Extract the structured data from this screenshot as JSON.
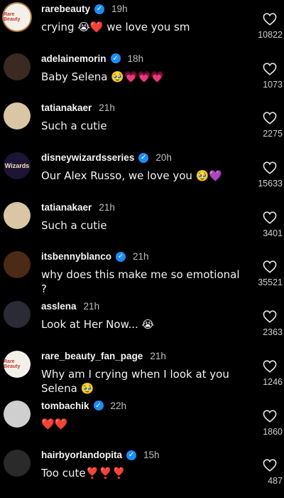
{
  "comments": [
    {
      "username": "rarebeauty",
      "verified": true,
      "time": "19h",
      "text": "crying 😭❤️ we love you sm",
      "likes": "10822",
      "avatar": {
        "label": "Rare Beauty",
        "bg": "#f3f0ea",
        "fg": "#c0392b",
        "ring": true
      }
    },
    {
      "username": "adelainemorin",
      "verified": true,
      "time": "18h",
      "text": "Baby Selena 🥹💗💗💗",
      "likes": "1073",
      "avatar": {
        "label": "",
        "bg": "#3a2a22",
        "fg": "#fff",
        "ring": false
      }
    },
    {
      "username": "tatianakaer",
      "verified": false,
      "time": "21h",
      "text": "Such a cutie",
      "likes": "2275",
      "avatar": {
        "label": "",
        "bg": "#d9c6a5",
        "fg": "#fff",
        "ring": false
      }
    },
    {
      "username": "disneywizardsseries",
      "verified": true,
      "time": "20h",
      "text": "Our Alex Russo, we love you 🥹💜",
      "likes": "15633",
      "avatar": {
        "label": "Wizards",
        "bg": "#1c1536",
        "fg": "#f3e3b0",
        "ring": false
      }
    },
    {
      "username": "tatianakaer",
      "verified": false,
      "time": "21h",
      "text": "Such a cutie",
      "likes": "3401",
      "avatar": {
        "label": "",
        "bg": "#d9c6a5",
        "fg": "#fff",
        "ring": false
      }
    },
    {
      "username": "itsbennyblanco",
      "verified": true,
      "time": "21h",
      "text": "why does this make me so emotional ?",
      "likes": "35521",
      "avatar": {
        "label": "",
        "bg": "#4b2a16",
        "fg": "#fff",
        "ring": false
      }
    },
    {
      "username": "asslena",
      "verified": false,
      "time": "21h",
      "text": "Look at Her Now... 😭",
      "likes": "2363",
      "avatar": {
        "label": "",
        "bg": "#2b2b35",
        "fg": "#fff",
        "ring": false
      }
    },
    {
      "username": "rare_beauty_fan_page",
      "verified": false,
      "time": "21h",
      "text": "Why am I crying when I look at you Selena 🥹",
      "likes": "1246",
      "avatar": {
        "label": "Rare Beauty",
        "bg": "#f3f0ea",
        "fg": "#c0392b",
        "ring": false
      }
    },
    {
      "username": "tombachik",
      "verified": true,
      "time": "22h",
      "text": "❤️❤️",
      "likes": "1860",
      "avatar": {
        "label": "",
        "bg": "#cfcfcf",
        "fg": "#111",
        "ring": false
      }
    },
    {
      "username": "hairbyorlandopita",
      "verified": true,
      "time": "15h",
      "text": "Too cute❣️❣️❣️",
      "likes": "487",
      "avatar": {
        "label": "",
        "bg": "#2a2a2a",
        "fg": "#fff",
        "ring": false
      }
    }
  ]
}
